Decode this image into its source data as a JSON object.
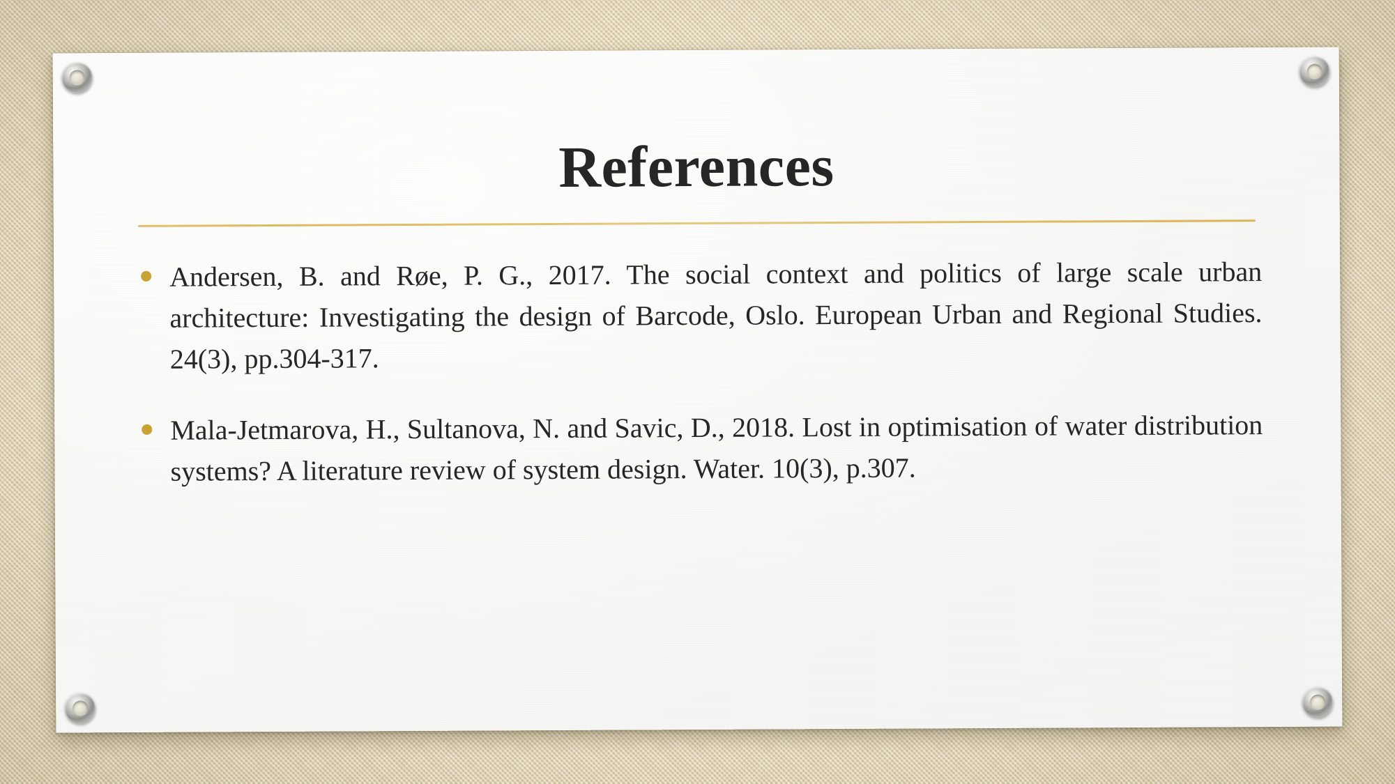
{
  "slide": {
    "title": "References",
    "background_color": "#e9dec2",
    "card_color": "#f7f7f6",
    "accent_color": "#c8a233",
    "divider_color": "#dcb95f",
    "text_color": "#262626"
  },
  "divider": {
    "name": "title-divider"
  },
  "references": [
    {
      "bullet": "bullet-dot",
      "text": "Andersen, B. and Røe, P. G., 2017. The social context and politics of large scale urban architecture: Investigating the design of Barcode, Oslo. European Urban and Regional Studies. 24(3), pp.304-317."
    },
    {
      "bullet": "bullet-dot",
      "text": "Mala-Jetmarova, H., Sultanova, N. and Savic, D., 2018. Lost in optimisation of water distribution systems? A literature review of system design. Water. 10(3), p.307."
    }
  ],
  "grommets": [
    {
      "position": "top-left"
    },
    {
      "position": "top-right"
    },
    {
      "position": "bottom-left"
    },
    {
      "position": "bottom-right"
    }
  ]
}
